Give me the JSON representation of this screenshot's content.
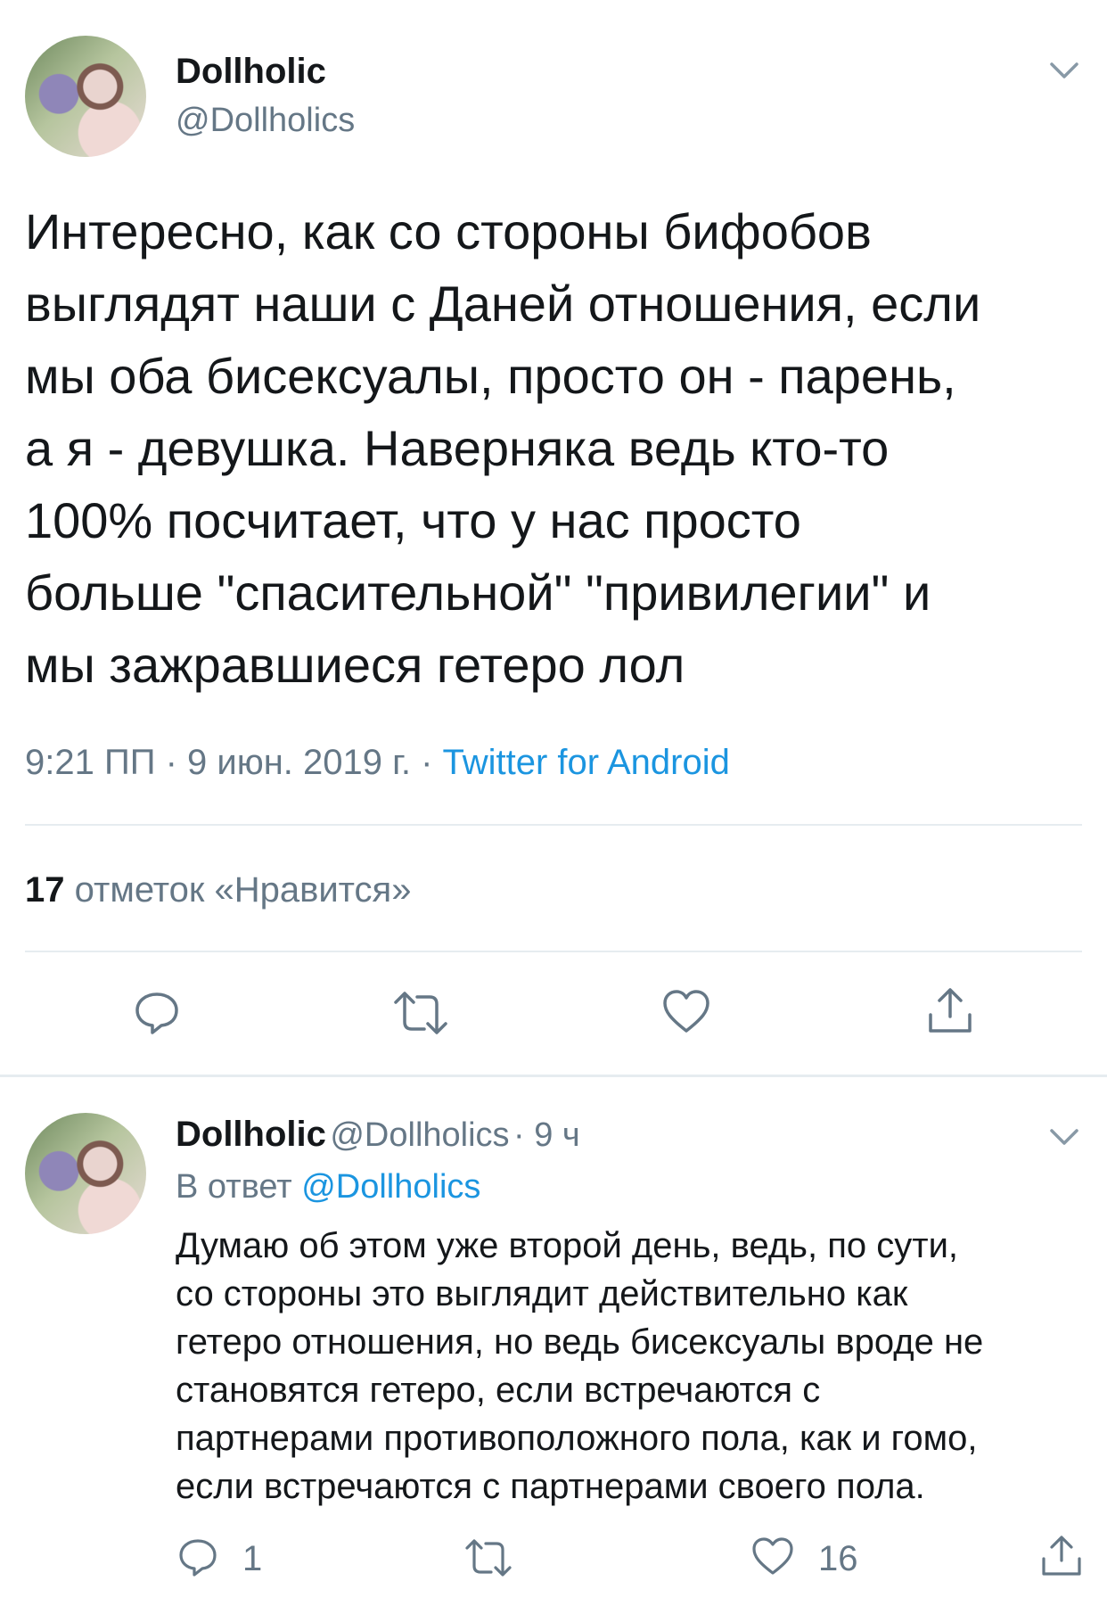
{
  "main_tweet": {
    "author_name": "Dollholic",
    "author_handle": "@Dollholics",
    "text": "Интересно, как со стороны бифобов\nвыглядят наши с Даней отношения, если\nмы оба бисексуалы, просто он - парень,\nа я - девушка. Наверняка ведь кто-то\n100% посчитает, что у нас просто\nбольше \"спасительной\" \"привилегии\" и\nмы зажравшиеся гетеро лол",
    "timestamp": "9:21 ПП · 9 июн. 2019 г. · ",
    "source": "Twitter for Android",
    "likes_count": "17",
    "likes_label": "отметок «Нравится»",
    "actions": [
      "reply-icon",
      "retweet-icon",
      "heart-icon",
      "share-icon"
    ]
  },
  "reply_tweet": {
    "author_name": "Dollholic",
    "author_handle": "@Dollholics",
    "time": "· 9 ч",
    "in_reply_prefix": "В ответ ",
    "in_reply_handle": "@Dollholics",
    "text": "Думаю об этом уже второй день,  ведь, по сути,\nсо стороны это выглядит действительно как\nгетеро отношения, но ведь бисексуалы вроде не\nстановятся гетеро, если встречаются с\nпартнерами противоположного пола, как и гомо,\nесли встречаются с партнерами своего пола.",
    "reply_count": "1",
    "like_count": "16"
  },
  "colors": {
    "text": "#14171a",
    "secondary": "#657786",
    "link": "#1b95e0",
    "divider": "#e6ecf0"
  }
}
